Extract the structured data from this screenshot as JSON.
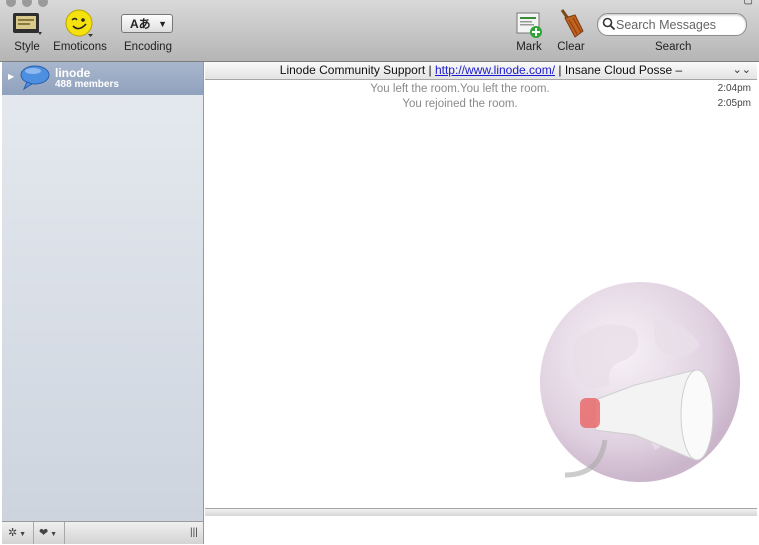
{
  "toolbar": {
    "style_label": "Style",
    "emoticons_label": "Emoticons",
    "encoding_label": "Encoding",
    "encoding_button_text": "Aあ",
    "mark_label": "Mark",
    "clear_label": "Clear",
    "search_label": "Search",
    "search_placeholder": "Search Messages"
  },
  "sidebar": {
    "rooms": [
      {
        "name": "linode",
        "members": "488 members"
      }
    ]
  },
  "topic": {
    "prefix": "Linode Community Support | ",
    "link": "http://www.linode.com/",
    "suffix": " | Insane Cloud Posse –"
  },
  "messages": [
    {
      "text": "You left the room.You left the room.",
      "time": "2:04pm"
    },
    {
      "text": "You rejoined the room.",
      "time": "2:05pm"
    }
  ],
  "bottom_bar": {
    "gear": "✲",
    "heart": "❤",
    "resize": "|||"
  },
  "colors": {
    "accent": "#8fa1bd",
    "link": "#1a1ad0"
  }
}
